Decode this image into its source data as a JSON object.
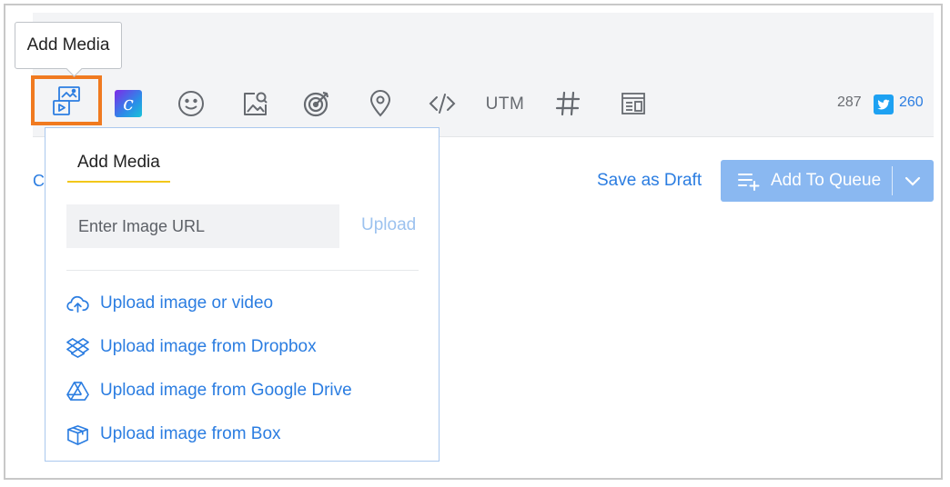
{
  "tooltip": {
    "text": "Add Media"
  },
  "toolbar": {
    "icons": [
      "add-media-icon",
      "canva-icon",
      "emoji-icon",
      "image-search-icon",
      "target-icon",
      "location-pin-icon",
      "code-icon",
      "utm",
      "hashtag-icon",
      "layout-icon"
    ],
    "canva_letter": "c",
    "utm_label": "UTM",
    "char_count": "287",
    "twitter_count": "260",
    "accent_color": "#f07a20"
  },
  "actions": {
    "left_truncated": "C",
    "save_draft": "Save as Draft",
    "add_to_queue": "Add To Queue"
  },
  "media_dropdown": {
    "tab": "Add Media",
    "url_placeholder": "Enter Image URL",
    "url_value": "",
    "upload": "Upload",
    "options": [
      {
        "label": "Upload image or video",
        "icon": "cloud-upload-icon"
      },
      {
        "label": "Upload image from Dropbox",
        "icon": "dropbox-icon"
      },
      {
        "label": "Upload image from Google Drive",
        "icon": "google-drive-icon"
      },
      {
        "label": "Upload image from Box",
        "icon": "box-icon"
      }
    ]
  },
  "colors": {
    "link": "#2b7de1",
    "button_disabled": "#8ab8f1",
    "twitter": "#1da1f2"
  }
}
